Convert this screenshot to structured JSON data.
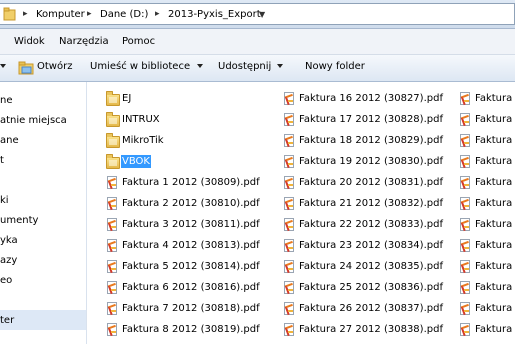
{
  "address": {
    "crumbs": [
      "Komputer",
      "Dane (D:)",
      "2013-Pyxis_Export"
    ]
  },
  "menu": [
    "Widok",
    "Narzędzia",
    "Pomoc"
  ],
  "toolbar": {
    "open": "Otwórz",
    "include_library": "Umieść w bibliotece",
    "share": "Udostępnij",
    "new_folder": "Nowy folder"
  },
  "nav": [
    "ne",
    "atnie miejsca",
    "ane",
    "t",
    "ki",
    "umenty",
    "yka",
    "azy",
    "eo",
    "ter"
  ],
  "files": {
    "col1": [
      {
        "type": "folder",
        "name": "EJ"
      },
      {
        "type": "folder",
        "name": "INTRUX"
      },
      {
        "type": "folder",
        "name": "MikroTik"
      },
      {
        "type": "folder",
        "name": "VBOK",
        "selected": true
      },
      {
        "type": "pdf",
        "name": "Faktura 1 2012 (30809).pdf"
      },
      {
        "type": "pdf",
        "name": "Faktura 2 2012 (30810).pdf"
      },
      {
        "type": "pdf",
        "name": "Faktura 3 2012 (30811).pdf"
      },
      {
        "type": "pdf",
        "name": "Faktura 4 2012 (30813).pdf"
      },
      {
        "type": "pdf",
        "name": "Faktura 5 2012 (30814).pdf"
      },
      {
        "type": "pdf",
        "name": "Faktura 6 2012 (30816).pdf"
      },
      {
        "type": "pdf",
        "name": "Faktura 7 2012 (30818).pdf"
      },
      {
        "type": "pdf",
        "name": "Faktura 8 2012 (30819).pdf"
      }
    ],
    "col2": [
      {
        "type": "pdf",
        "name": "Faktura 16 2012 (30827).pdf"
      },
      {
        "type": "pdf",
        "name": "Faktura 17 2012 (30828).pdf"
      },
      {
        "type": "pdf",
        "name": "Faktura 18 2012 (30829).pdf"
      },
      {
        "type": "pdf",
        "name": "Faktura 19 2012 (30830).pdf"
      },
      {
        "type": "pdf",
        "name": "Faktura 20 2012 (30831).pdf"
      },
      {
        "type": "pdf",
        "name": "Faktura 21 2012 (30832).pdf"
      },
      {
        "type": "pdf",
        "name": "Faktura 22 2012 (30833).pdf"
      },
      {
        "type": "pdf",
        "name": "Faktura 23 2012 (30834).pdf"
      },
      {
        "type": "pdf",
        "name": "Faktura 24 2012 (30835).pdf"
      },
      {
        "type": "pdf",
        "name": "Faktura 25 2012 (30836).pdf"
      },
      {
        "type": "pdf",
        "name": "Faktura 26 2012 (30837).pdf"
      },
      {
        "type": "pdf",
        "name": "Faktura 27 2012 (30838).pdf"
      }
    ],
    "col3": [
      "Faktura",
      "Faktura",
      "Faktura",
      "Faktura",
      "Faktura",
      "Faktura",
      "Faktura",
      "Faktura",
      "Faktura",
      "Faktura",
      "Faktura",
      "Faktura"
    ]
  }
}
